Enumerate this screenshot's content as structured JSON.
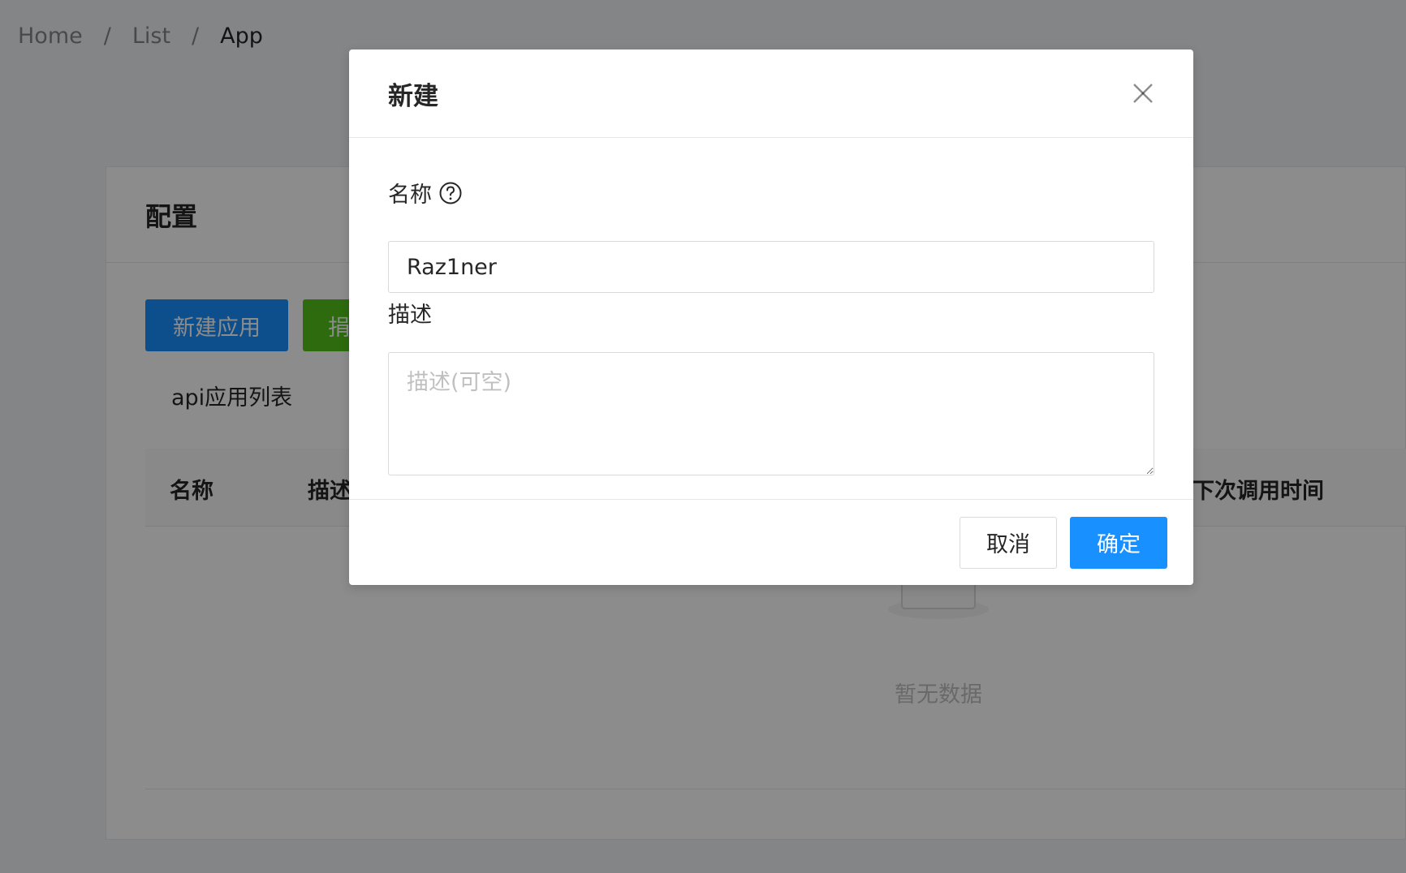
{
  "breadcrumb": {
    "items": [
      "Home",
      "List",
      "App"
    ],
    "separator": "/"
  },
  "card": {
    "title": "配置",
    "buttons": {
      "new_app": "新建应用",
      "second": "捐"
    },
    "list_title": "api应用列表",
    "table": {
      "columns": [
        "名称",
        "描述",
        "下次调用时间"
      ]
    },
    "empty_text": "暂无数据"
  },
  "modal": {
    "title": "新建",
    "name_label": "名称",
    "name_value": "Raz1ner",
    "desc_label": "描述",
    "desc_placeholder": "描述(可空)",
    "cancel_label": "取消",
    "ok_label": "确定"
  },
  "colors": {
    "primary": "#1890ff",
    "success": "#52c41a",
    "mask": "rgba(0,0,0,0.45)"
  },
  "icons": {
    "close": "close-icon",
    "help": "question-circle-icon",
    "empty": "inbox-icon"
  }
}
